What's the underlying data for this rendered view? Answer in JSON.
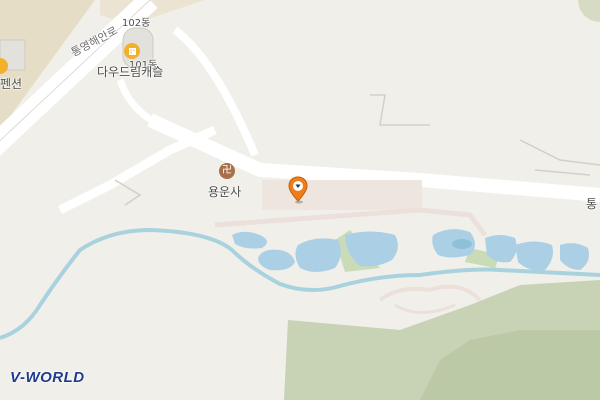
{
  "map": {
    "labels": {
      "road": "통영해안로",
      "building_102": "102동",
      "building_101": "101동",
      "dauden": "다우드림캐슬",
      "pension": "펜션",
      "temple": "용운사",
      "edge_text": "통"
    },
    "icons": {
      "temple": "temple-icon",
      "building": "building-icon",
      "pin": "location-pin-icon"
    },
    "colors": {
      "background": "#f1efe9",
      "road": "#ffffff",
      "water": "#abd0e6",
      "park": "#c8d8b3",
      "pin": "#f07d1b",
      "logo": "#1e3c8c"
    }
  },
  "branding": {
    "logo": "V-WORLD"
  }
}
